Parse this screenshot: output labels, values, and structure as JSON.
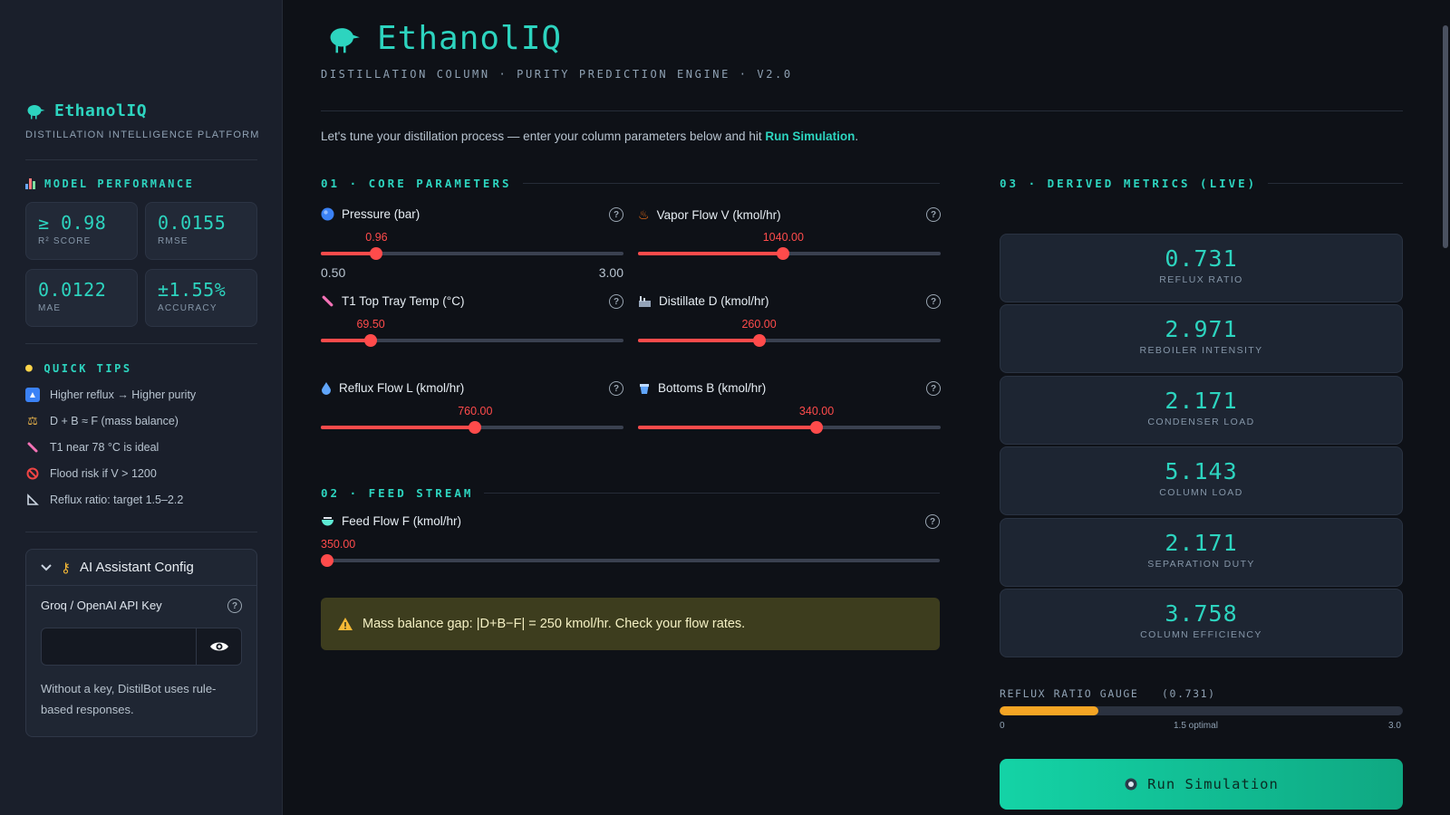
{
  "sidebar": {
    "brand": "EthanolIQ",
    "subtitle": "DISTILLATION INTELLIGENCE PLATFORM",
    "model_performance_title": "MODEL PERFORMANCE",
    "metrics": [
      {
        "value": "≥ 0.98",
        "label": "R² SCORE"
      },
      {
        "value": "0.0155",
        "label": "RMSE"
      },
      {
        "value": "0.0122",
        "label": "MAE"
      },
      {
        "value": "±1.55%",
        "label": "ACCURACY"
      }
    ],
    "quick_tips_title": "QUICK TIPS",
    "tips": [
      {
        "icon": "arrow-up-icon",
        "text": "Higher reflux → Higher purity"
      },
      {
        "icon": "scale-icon",
        "text": "D + B ≈ F (mass balance)"
      },
      {
        "icon": "thermometer-icon",
        "text": "T1 near 78 °C is ideal"
      },
      {
        "icon": "no-entry-icon",
        "text": "Flood risk if V > 1200"
      },
      {
        "icon": "triangle-ruler-icon",
        "text": "Reflux ratio: target 1.5–2.2"
      }
    ],
    "ai_config": {
      "title": "AI Assistant Config",
      "key_label": "Groq / OpenAI API Key",
      "key_value": "",
      "note": "Without a key, DistilBot uses rule-based responses."
    }
  },
  "header": {
    "title": "EthanolIQ",
    "subtitle": "DISTILLATION COLUMN · PURITY PREDICTION ENGINE · V2.0",
    "intro_before": "Let's tune your distillation process — enter your column parameters below and hit ",
    "intro_link": "Run Simulation",
    "intro_after": "."
  },
  "core": {
    "title": "01 · CORE PARAMETERS",
    "params": [
      {
        "label": "Pressure (bar)",
        "value": "0.96",
        "fraction": 0.184,
        "min": "0.50",
        "max": "3.00",
        "icon": "blue-circle-icon"
      },
      {
        "label": "Vapor Flow V (kmol/hr)",
        "value": "1040.00",
        "fraction": 0.48,
        "icon": "flame-icon"
      },
      {
        "label": "T1 Top Tray Temp (°C)",
        "value": "69.50",
        "fraction": 0.165,
        "icon": "thermometer-icon"
      },
      {
        "label": "Distillate D (kmol/hr)",
        "value": "260.00",
        "fraction": 0.4,
        "icon": "factory-icon"
      },
      {
        "label": "Reflux Flow L (kmol/hr)",
        "value": "760.00",
        "fraction": 0.51,
        "icon": "droplet-icon"
      },
      {
        "label": "Bottoms B (kmol/hr)",
        "value": "340.00",
        "fraction": 0.59,
        "icon": "beaker-icon"
      }
    ]
  },
  "feed": {
    "title": "02 · FEED STREAM",
    "label": "Feed Flow F (kmol/hr)",
    "value": "350.00",
    "fraction": 0.0,
    "icon": "bowl-icon"
  },
  "warning": {
    "text": "Mass balance gap: |D+B−F| = 250 kmol/hr. Check your flow rates."
  },
  "derived": {
    "title": "03 · DERIVED METRICS (LIVE)",
    "metrics": [
      {
        "value": "0.731",
        "label": "REFLUX RATIO"
      },
      {
        "value": "2.971",
        "label": "REBOILER INTENSITY"
      },
      {
        "value": "2.171",
        "label": "CONDENSER LOAD"
      },
      {
        "value": "5.143",
        "label": "COLUMN LOAD"
      },
      {
        "value": "2.171",
        "label": "SEPARATION DUTY"
      },
      {
        "value": "3.758",
        "label": "COLUMN EFFICIENCY"
      }
    ],
    "gauge_label": "REFLUX RATIO GAUGE",
    "gauge_value": "(0.731)",
    "gauge_fraction": 0.244,
    "gauge_min": "0",
    "gauge_mid": "1.5 optimal",
    "gauge_max": "3.0"
  },
  "run_button": "Run Simulation",
  "colors": {
    "accent": "#2dd4bf",
    "slider": "#ff4b4b",
    "gauge": "#f5a524",
    "warning_bg": "#3d3d1e"
  }
}
